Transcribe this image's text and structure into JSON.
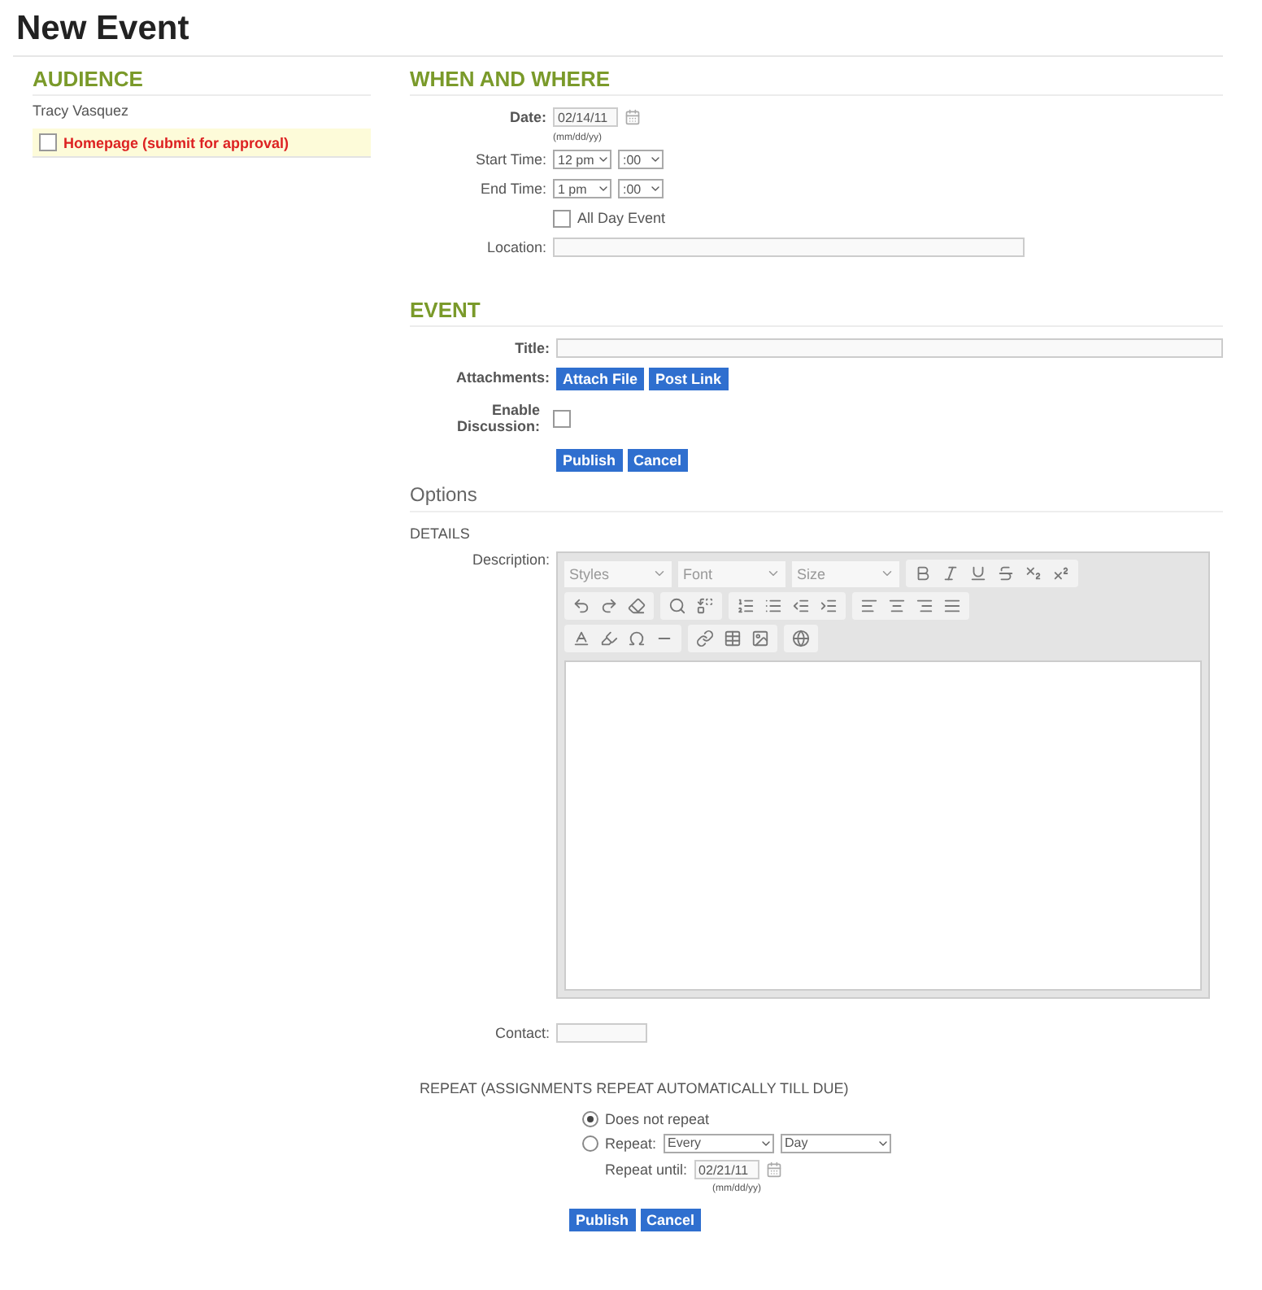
{
  "page": {
    "title": "New Event"
  },
  "audience": {
    "heading": "AUDIENCE",
    "person": "Tracy Vasquez",
    "options": [
      {
        "label": "Homepage (submit for approval)",
        "checked": false
      }
    ]
  },
  "when_where": {
    "heading": "WHEN AND WHERE",
    "date_label": "Date:",
    "date_value": "02/14/11",
    "date_hint": "(mm/dd/yy)",
    "start_label": "Start Time:",
    "start_hour": "12 pm",
    "start_min": ":00",
    "end_label": "End Time:",
    "end_hour": "1 pm",
    "end_min": ":00",
    "all_day": {
      "label": "All Day Event",
      "checked": false
    },
    "location_label": "Location:"
  },
  "event": {
    "heading": "EVENT",
    "title_label": "Title:",
    "attachments_label": "Attachments:",
    "attach_buttons": [
      "Attach File",
      "Post Link"
    ],
    "discussion_label": "Enable Discussion:",
    "discussion_checked": false,
    "buttons": [
      "Publish",
      "Cancel"
    ]
  },
  "options": {
    "heading": "Options",
    "details_heading": "DETAILS",
    "description_label": "Description:",
    "editor_selects": [
      "Styles",
      "Font",
      "Size"
    ],
    "contact_label": "Contact:"
  },
  "repeat": {
    "heading": "REPEAT (ASSIGNMENTS REPEAT AUTOMATICALLY TILL DUE)",
    "choices": [
      {
        "label": "Does not repeat",
        "selected": true
      },
      {
        "label": "Repeat:",
        "selected": false
      }
    ],
    "every": "Every",
    "unit": "Day",
    "until_label": "Repeat until:",
    "until_value": "02/21/11",
    "until_hint": "(mm/dd/yy)",
    "buttons": [
      "Publish",
      "Cancel"
    ]
  }
}
